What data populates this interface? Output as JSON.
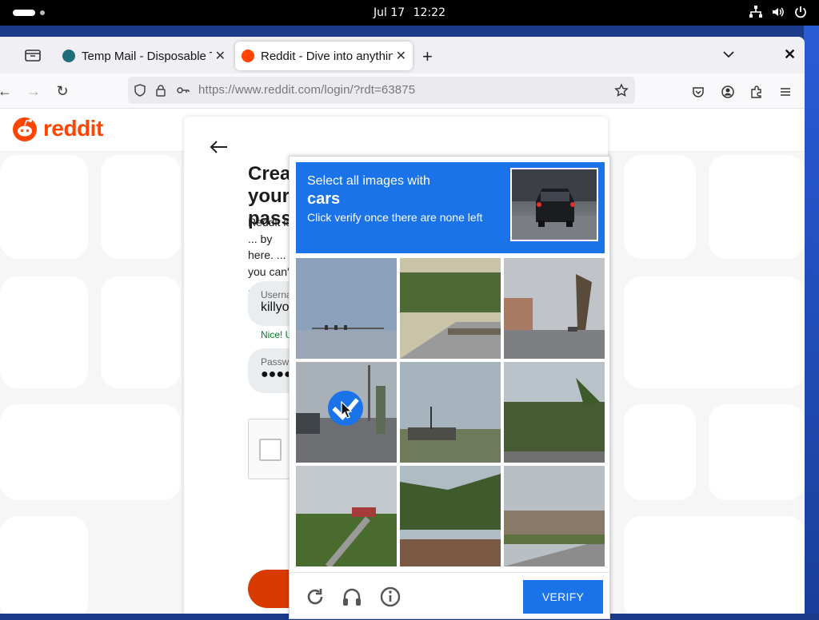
{
  "system": {
    "clock": {
      "date": "Jul 17",
      "time": "12:22"
    },
    "tray_icons": [
      "network-icon",
      "volume-icon",
      "power-icon"
    ]
  },
  "browser": {
    "tabs": [
      {
        "title": "Temp Mail - Disposable Te",
        "favicon": "tempmail-icon",
        "active": false
      },
      {
        "title": "Reddit - Dive into anything",
        "favicon": "reddit-icon",
        "active": true
      }
    ],
    "url": "https://www.reddit.com/login/?rdt=63875"
  },
  "page": {
    "logo_text": "reddit",
    "heading": "Create your password",
    "description": "Reddit is ... by here. ... you can't ...",
    "username": {
      "label": "Username",
      "value": "killyo"
    },
    "username_status": "Nice! U",
    "password": {
      "label": "Password",
      "value": "●●●●"
    }
  },
  "captcha": {
    "prompt_line1": "Select all images with",
    "prompt_target": "cars",
    "prompt_line3": "Click verify once there are none left",
    "tiles": [
      {
        "index": 1,
        "selected": false
      },
      {
        "index": 2,
        "selected": false
      },
      {
        "index": 3,
        "selected": false
      },
      {
        "index": 4,
        "selected": true
      },
      {
        "index": 5,
        "selected": false
      },
      {
        "index": 6,
        "selected": false
      },
      {
        "index": 7,
        "selected": false
      },
      {
        "index": 8,
        "selected": false
      },
      {
        "index": 9,
        "selected": false
      }
    ],
    "verify_label": "VERIFY",
    "footer_icons": [
      "refresh-icon",
      "audio-challenge-icon",
      "info-icon"
    ]
  },
  "colors": {
    "reddit_orange": "#ff4500",
    "captcha_blue": "#1a73e8"
  }
}
